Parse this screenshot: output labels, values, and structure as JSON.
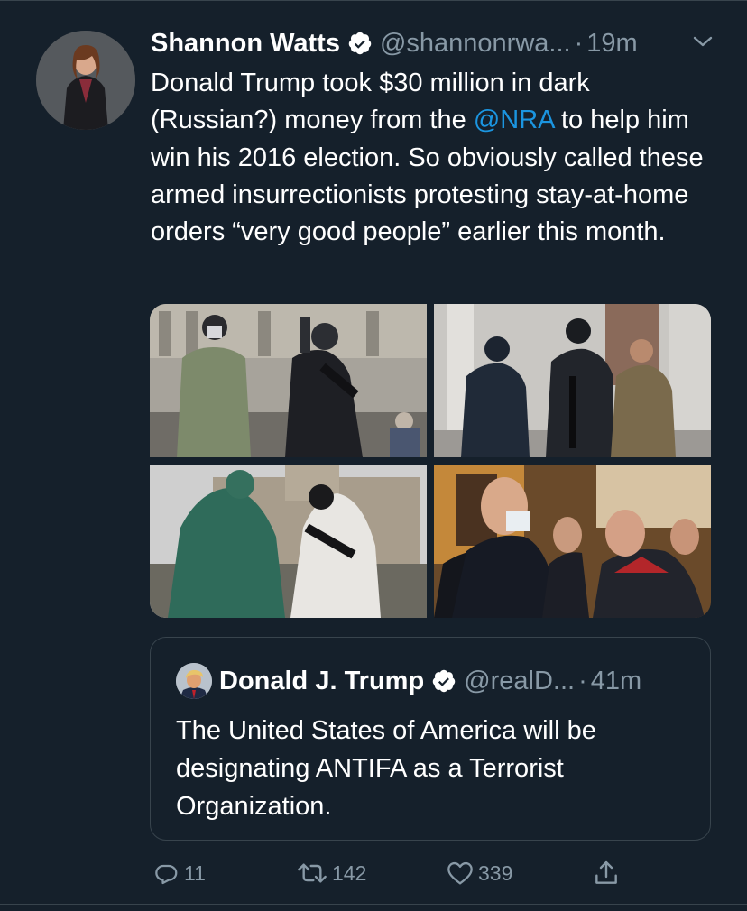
{
  "tweet": {
    "author_name": "Shannon Watts",
    "handle": "@shannonrwa...",
    "separator": "·",
    "time": "19m",
    "text_before": "Donald Trump took $30 million in dark (Russian?) money from the ",
    "mention": "@NRA",
    "text_after": " to help him win his 2016 election. So obviously called these armed insurrectionists protesting stay-at-home orders “very good people” earlier this month."
  },
  "quoted_tweet": {
    "author_name": "Donald J. Trump",
    "handle": "@realD...",
    "separator": "·",
    "time": "41m",
    "text": "The United States of America will be designating ANTIFA as a Terrorist Organization."
  },
  "actions": {
    "replies": "11",
    "retweets": "142",
    "likes": "339"
  },
  "colors": {
    "background": "#15202b",
    "link": "#1b95e0",
    "secondary_text": "#8899a6",
    "border": "#38444d"
  },
  "icons": {
    "verified": "verified-badge-icon",
    "more": "chevron-down-icon",
    "reply": "reply-icon",
    "retweet": "retweet-icon",
    "like": "heart-icon",
    "share": "share-icon"
  }
}
